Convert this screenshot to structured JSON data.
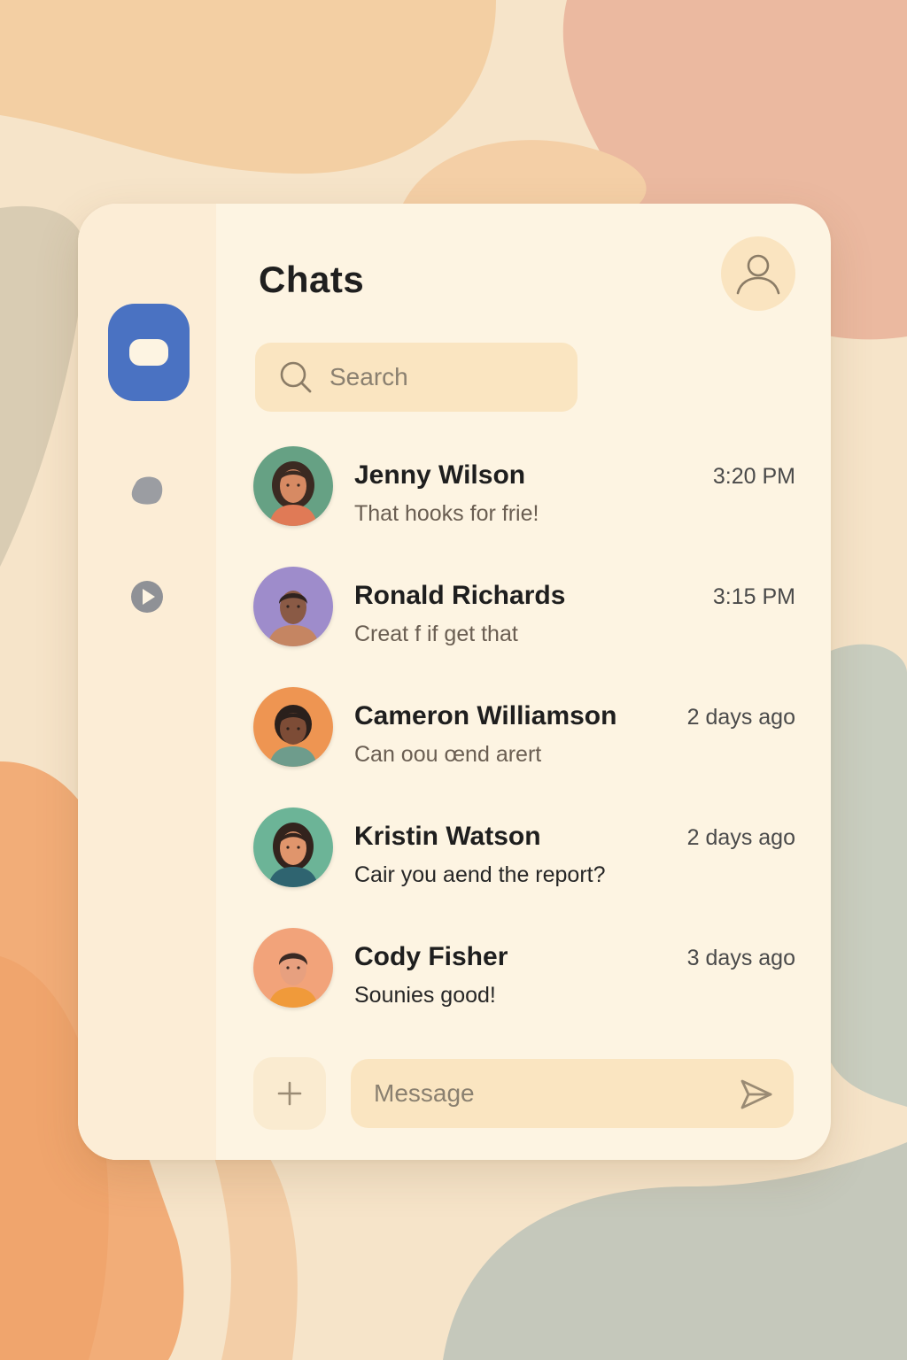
{
  "header": {
    "title": "Chats"
  },
  "search": {
    "placeholder": "Search"
  },
  "sidebar": {
    "items": [
      {
        "icon": "chat-bubble-icon",
        "active": true,
        "color": "#4a72c2"
      },
      {
        "icon": "blob-icon",
        "active": false,
        "color": "#9b9da2"
      },
      {
        "icon": "play-icon",
        "active": false,
        "color": "#8f9196"
      }
    ]
  },
  "conversations": [
    {
      "name": "Jenny Wilson",
      "time": "3:20 PM",
      "preview": "That hooks for frie!",
      "avatar_color": "#66a184"
    },
    {
      "name": "Ronald Richards",
      "time": "3:15 PM",
      "preview": "Creat  f if get that",
      "avatar_color": "#9e8ccb"
    },
    {
      "name": "Cameron Williamson",
      "time": "2 days ago",
      "preview": "Can oou œnd arert",
      "avatar_color": "#ee9552"
    },
    {
      "name": "Kristin Watson",
      "time": "2 days ago",
      "preview": "Cair you aend the report?",
      "avatar_color": "#6cb497"
    },
    {
      "name": "Cody Fisher",
      "time": "3 days ago",
      "preview": "Sounies good!",
      "avatar_color": "#f2a37a"
    }
  ],
  "composer": {
    "placeholder": "Message"
  },
  "colors": {
    "accent": "#4a72c2",
    "card_background": "#fdf4e2",
    "input_background": "#fae5c1"
  }
}
